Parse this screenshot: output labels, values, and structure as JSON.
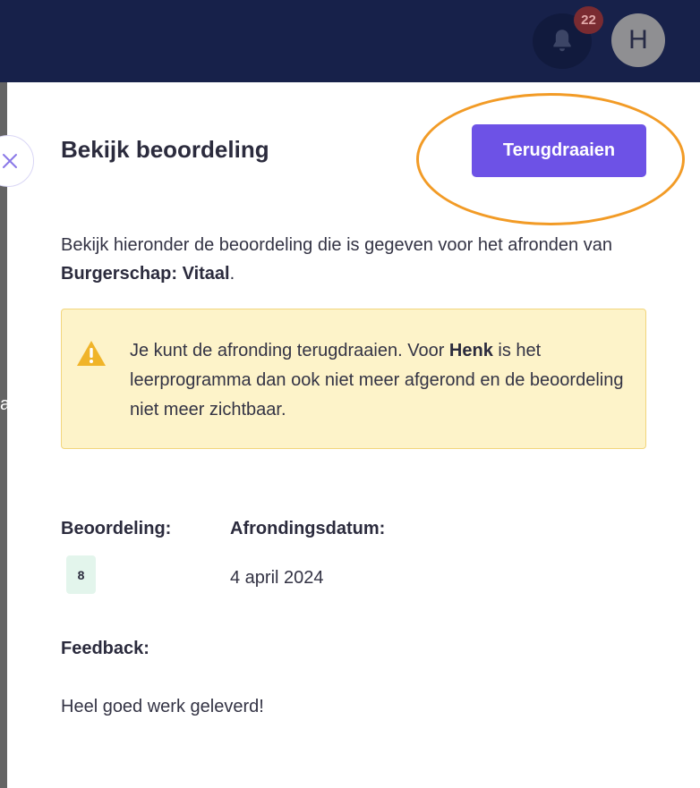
{
  "header": {
    "notification_count": "22",
    "avatar_initial": "H"
  },
  "backdrop": {
    "letter": "a"
  },
  "panel": {
    "title": "Bekijk beoordeling",
    "revert_button_label": "Terugdraaien",
    "intro": {
      "prefix": "Bekijk hieronder de beoordeling die is gegeven voor het afronden van ",
      "program": "Burgerschap: Vitaal",
      "suffix": "."
    },
    "warning": {
      "prefix": "Je kunt de afronding terugdraaien. Voor ",
      "name": "Henk",
      "suffix": " is het leerprogramma dan ook niet meer afgerond en de beoordeling niet meer zichtbaar."
    },
    "grade_label": "Beoordeling:",
    "grade_value": "8",
    "date_label": "Afrondingsdatum:",
    "date_value": "4 april 2024",
    "feedback_label": "Feedback:",
    "feedback_value": "Heel goed werk geleverd!"
  },
  "colors": {
    "topbar": "#17214a",
    "primary": "#6d52e6",
    "warning_bg": "#fdf3c9",
    "warning_icon": "#f0b429",
    "annotation": "#f29b26",
    "grade_chip": "#e3f5ec"
  },
  "icons": {
    "notifications": "bell-icon",
    "close": "close-icon",
    "warning": "warning-triangle-icon"
  }
}
